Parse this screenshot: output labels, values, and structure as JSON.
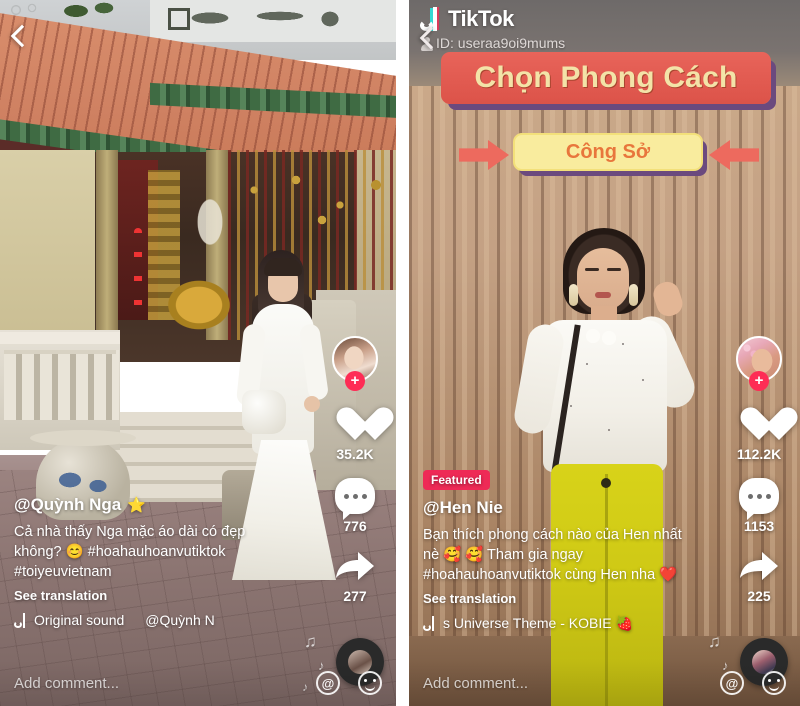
{
  "app": {
    "name": "TikTok",
    "watermark_label": "TikTok"
  },
  "left_video": {
    "back_icon": "back-chevron-icon",
    "author": "@Quỳnh Nga",
    "author_badge": "⭐",
    "description": "Cả nhà thấy Nga mặc áo dài có đẹp không? 😊 #hoahauhoanvutiktok #toiyeuvietnam",
    "see_translation": "See translation",
    "sound_name": "Original sound",
    "sound_author": "@Quỳnh N",
    "likes": "35.2K",
    "comments": "776",
    "shares": "277",
    "follow_plus": "+",
    "comment_placeholder": "Add comment...",
    "at_icon_label": "@",
    "icons": {
      "heart": "heart-icon",
      "comment": "comment-icon",
      "share": "share-icon",
      "music_disc": "music-disc-icon",
      "emoji": "emoji-icon"
    }
  },
  "right_video": {
    "back_icon": "back-chevron-icon",
    "watermark_id": "ID: useraa9oi9mums",
    "overlay_title": "Chọn Phong Cách",
    "overlay_subtitle": "Công Sở",
    "featured_badge": "Featured",
    "author": "@Hen Nie",
    "description": "Bạn thích phong cách nào của Hen nhất nè 🥰 🥰 Tham gia ngay #hoahauhoanvutiktok cùng Hen nha ❤️",
    "see_translation": "See translation",
    "sound_name": "s Universe Theme - KOBIE 🍓",
    "likes": "112.2K",
    "comments": "1153",
    "shares": "225",
    "follow_plus": "+",
    "comment_placeholder": "Add comment...",
    "at_icon_label": "@",
    "icons": {
      "heart": "heart-icon",
      "comment": "comment-icon",
      "share": "share-icon",
      "music_disc": "music-disc-icon",
      "emoji": "emoji-icon"
    }
  },
  "colors": {
    "accent_pink": "#FE2C55",
    "featured_badge": "#EE2A56",
    "cyan": "#25F4EE",
    "banner_red": "#DC5349",
    "banner_yellow": "#F9EC9E",
    "banner_text_yellow": "#F3E3A8",
    "subtitle_orange": "#E8763C",
    "shadow_purple": "#6B4A7E",
    "arrow_coral": "#ED6A5E"
  }
}
